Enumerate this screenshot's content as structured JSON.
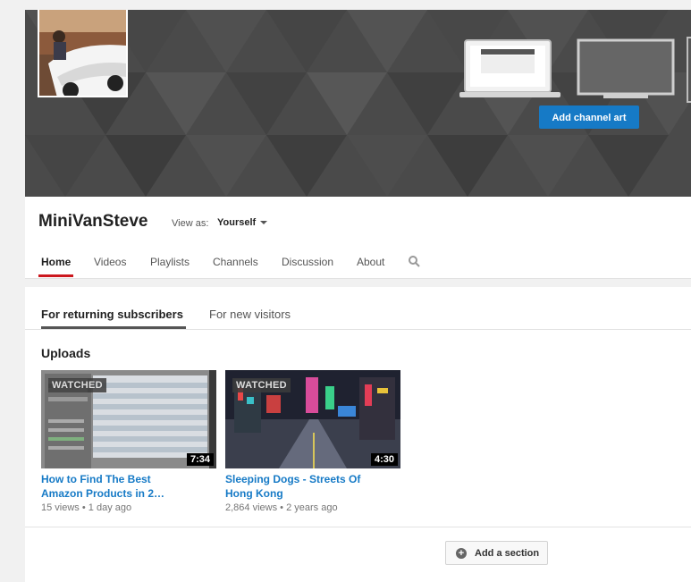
{
  "banner": {
    "add_channel_art_label": "Add channel art"
  },
  "channel": {
    "name": "MiniVanSteve",
    "view_as_label": "View as:",
    "view_as_value": "Yourself"
  },
  "tabs": [
    {
      "label": "Home",
      "active": true
    },
    {
      "label": "Videos"
    },
    {
      "label": "Playlists"
    },
    {
      "label": "Channels"
    },
    {
      "label": "Discussion"
    },
    {
      "label": "About"
    }
  ],
  "subtabs": [
    {
      "label": "For returning subscribers",
      "active": true
    },
    {
      "label": "For new visitors"
    }
  ],
  "uploads": {
    "title": "Uploads",
    "videos": [
      {
        "badge": "WATCHED",
        "duration": "7:34",
        "title_line1": "How to Find The Best",
        "title_line2": "Amazon Products in 2…",
        "views": "15 views",
        "age": "1 day ago"
      },
      {
        "badge": "WATCHED",
        "duration": "4:30",
        "title_line1": "Sleeping Dogs - Streets Of",
        "title_line2": "Hong Kong",
        "views": "2,864 views",
        "age": "2 years ago"
      }
    ]
  },
  "add_section_label": "Add a section",
  "meta_separator": "•",
  "colors": {
    "accent_blue": "#167ac6",
    "active_tab_red": "#cc181e",
    "banner_gray": "#4a4a4a"
  }
}
